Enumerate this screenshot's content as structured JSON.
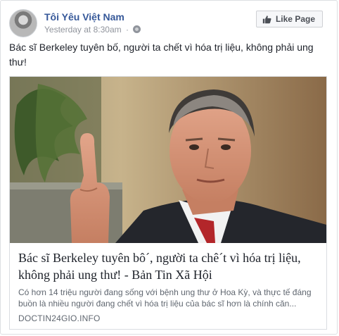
{
  "header": {
    "page_name": "Tôi Yêu Việt Nam",
    "timestamp": "Yesterday at 8:30am",
    "separator": "·",
    "audience_icon": "globe-icon",
    "like_button": {
      "label": "Like Page",
      "icon": "thumbs-up-icon"
    }
  },
  "post": {
    "text": "Bác sĩ Berkeley tuyên bố, người ta chết vì hóa trị liệu, không phải ung thư!"
  },
  "link_preview": {
    "title": "Bác sĩ Berkeley tuyên bô´, người ta chê´t vì hóa trị liệu, không phải ung thư! - Bản Tin Xã Hội",
    "description": "Có hơn 14 triệu người đang sống với bệnh ung thư ở Hoa Kỳ, và thực tế đáng buồn là nhiều người đang chết vì hóa trị liệu của bác sĩ hơn là chính căn...",
    "domain": "DOCTIN24GIO.INFO"
  },
  "colors": {
    "link_blue": "#365899",
    "meta_gray": "#90949c",
    "border": "#dddfe2"
  }
}
